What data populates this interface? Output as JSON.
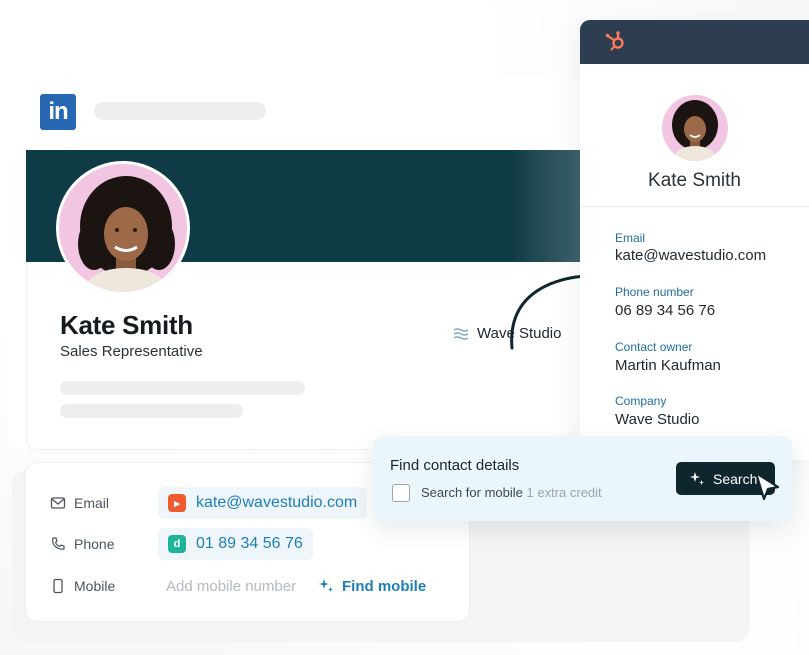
{
  "linkedin": {
    "logo_text": "in",
    "name": "Kate Smith",
    "title": "Sales Representative",
    "company": "Wave Studio"
  },
  "contact": {
    "email_label": "Email",
    "email_value": "kate@wavestudio.com",
    "phone_label": "Phone",
    "phone_value": "01 89 34 56 76",
    "mobile_label": "Mobile",
    "mobile_placeholder": "Add mobile number",
    "find_mobile_label": "Find mobile"
  },
  "hubspot": {
    "name": "Kate Smith",
    "fields": [
      {
        "label": "Email",
        "value": "kate@wavestudio.com"
      },
      {
        "label": "Phone number",
        "value": "06 89 34 56 76"
      },
      {
        "label": "Contact owner",
        "value": "Martin Kaufman"
      },
      {
        "label": "Company",
        "value": "Wave Studio"
      }
    ]
  },
  "find_popup": {
    "title": "Find contact details",
    "checkbox_label": "Search for mobile",
    "credit_note": "1 extra credit",
    "search_button": "Search"
  },
  "colors": {
    "linkedin_blue": "#2867b2",
    "banner_teal": "#0f3b46",
    "hubspot_header": "#2d3e50",
    "hubspot_orange": "#ff7a59",
    "link_blue": "#1e7fb6",
    "avatar_pink": "#f2c6e2"
  }
}
